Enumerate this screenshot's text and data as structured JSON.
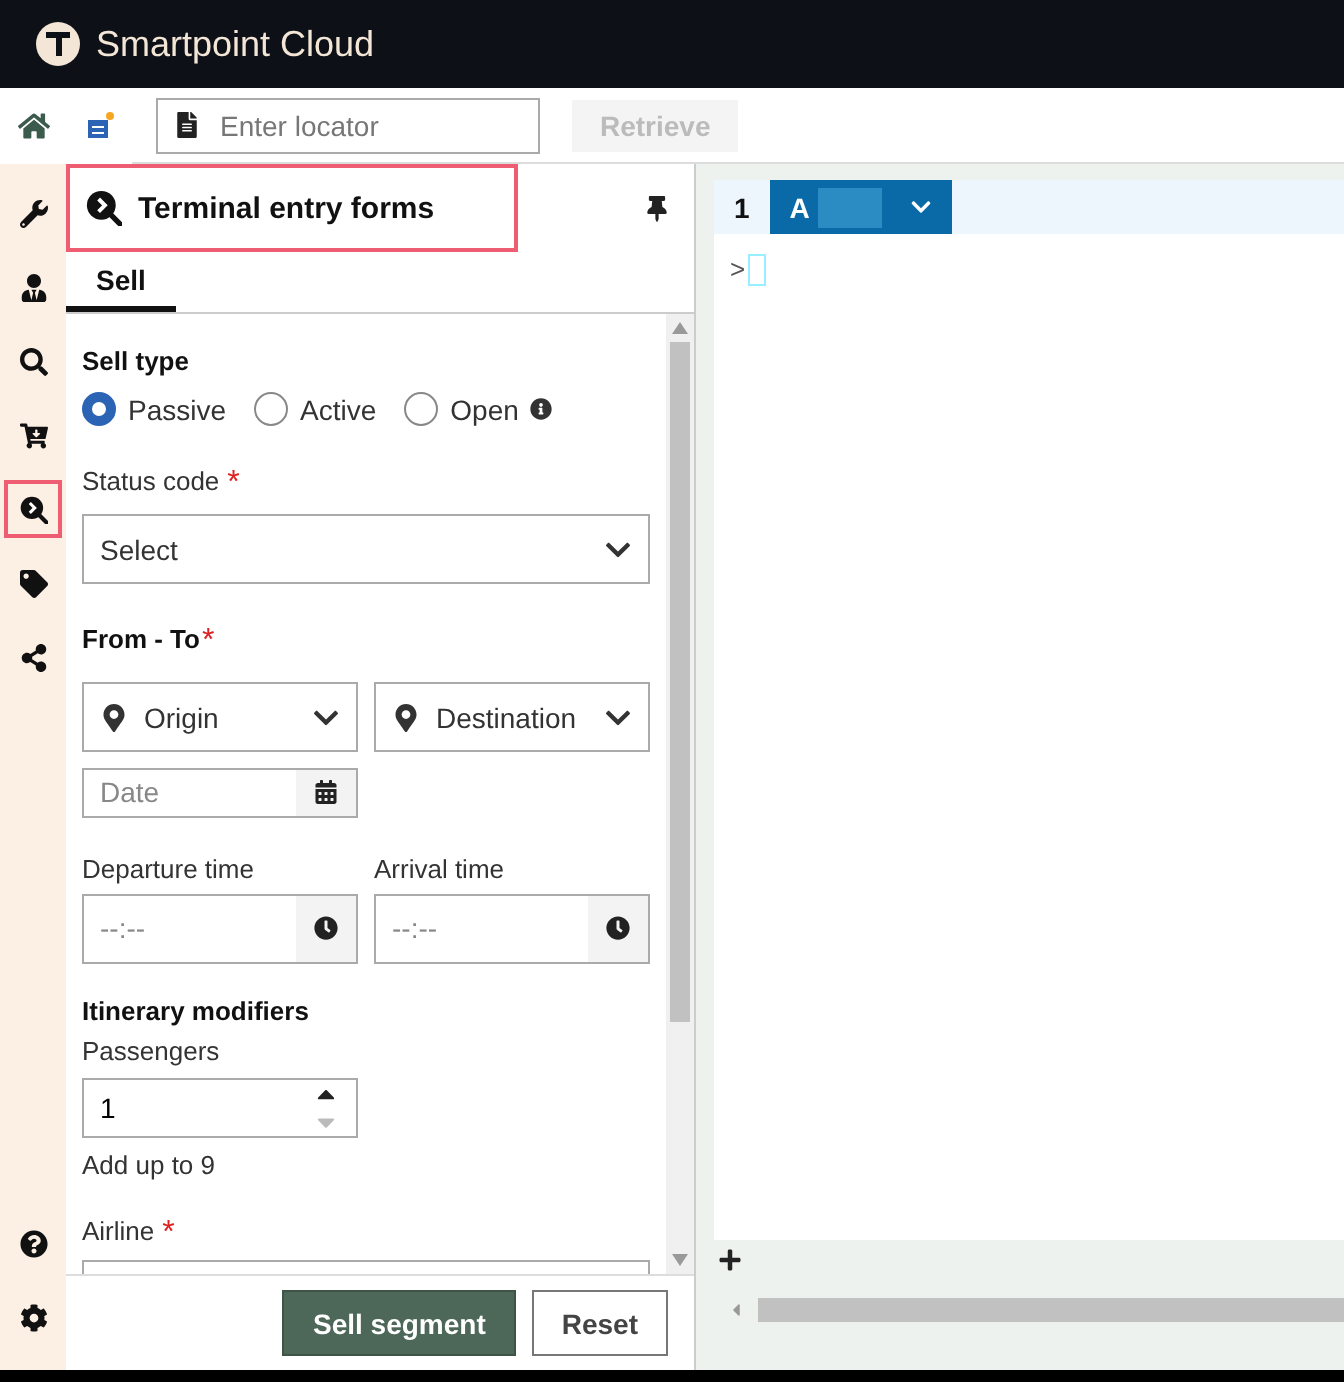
{
  "header": {
    "title": "Smartpoint Cloud"
  },
  "toolbar": {
    "locator": {
      "placeholder": "Enter locator"
    },
    "retrieve_button": {
      "label": "Retrieve",
      "disabled": true
    }
  },
  "rail": {
    "items": [
      {
        "kind": "wrench",
        "selected": false
      },
      {
        "kind": "profile",
        "selected": false
      },
      {
        "kind": "search",
        "selected": false
      },
      {
        "kind": "cart",
        "selected": false
      },
      {
        "kind": "forms",
        "selected": true
      },
      {
        "kind": "tag",
        "selected": false
      },
      {
        "kind": "share",
        "selected": false
      }
    ],
    "bottom_items": [
      {
        "kind": "help",
        "selected": false
      },
      {
        "kind": "settings",
        "selected": false
      }
    ]
  },
  "panel": {
    "title": "Terminal entry forms",
    "tabs": [
      {
        "label": "Sell",
        "selected": true
      }
    ]
  },
  "form": {
    "sell_type": {
      "label": "Sell type",
      "options": [
        {
          "label": "Passive",
          "selected": true,
          "info": false
        },
        {
          "label": "Active",
          "selected": false,
          "info": false
        },
        {
          "label": "Open",
          "selected": false,
          "info": true
        }
      ]
    },
    "status_code": {
      "label": "Status code",
      "required_mark": "*",
      "value": "Select"
    },
    "from_to": {
      "label": "From - To",
      "required_mark": "*",
      "origin": "Origin",
      "destination": "Destination",
      "date": {
        "placeholder": "Date"
      }
    },
    "departure_time": {
      "label": "Departure time",
      "placeholder": "--:--"
    },
    "arrival_time": {
      "label": "Arrival time",
      "placeholder": "--:--"
    },
    "itinerary_modifiers": {
      "heading": "Itinerary modifiers",
      "passengers": {
        "label": "Passengers",
        "value": "1",
        "decrement_disabled": true
      },
      "hint": "Add up to 9"
    },
    "airline": {
      "label": "Airline",
      "required_mark": "*"
    }
  },
  "footer": {
    "buttons": [
      {
        "label": "Sell segment",
        "kind": "primary"
      },
      {
        "label": "Reset",
        "kind": "secondary"
      }
    ]
  },
  "terminal": {
    "tabs": [
      {
        "label": "1",
        "selected": false
      },
      {
        "label": "A",
        "selected": true
      }
    ],
    "prompt": ">"
  }
}
